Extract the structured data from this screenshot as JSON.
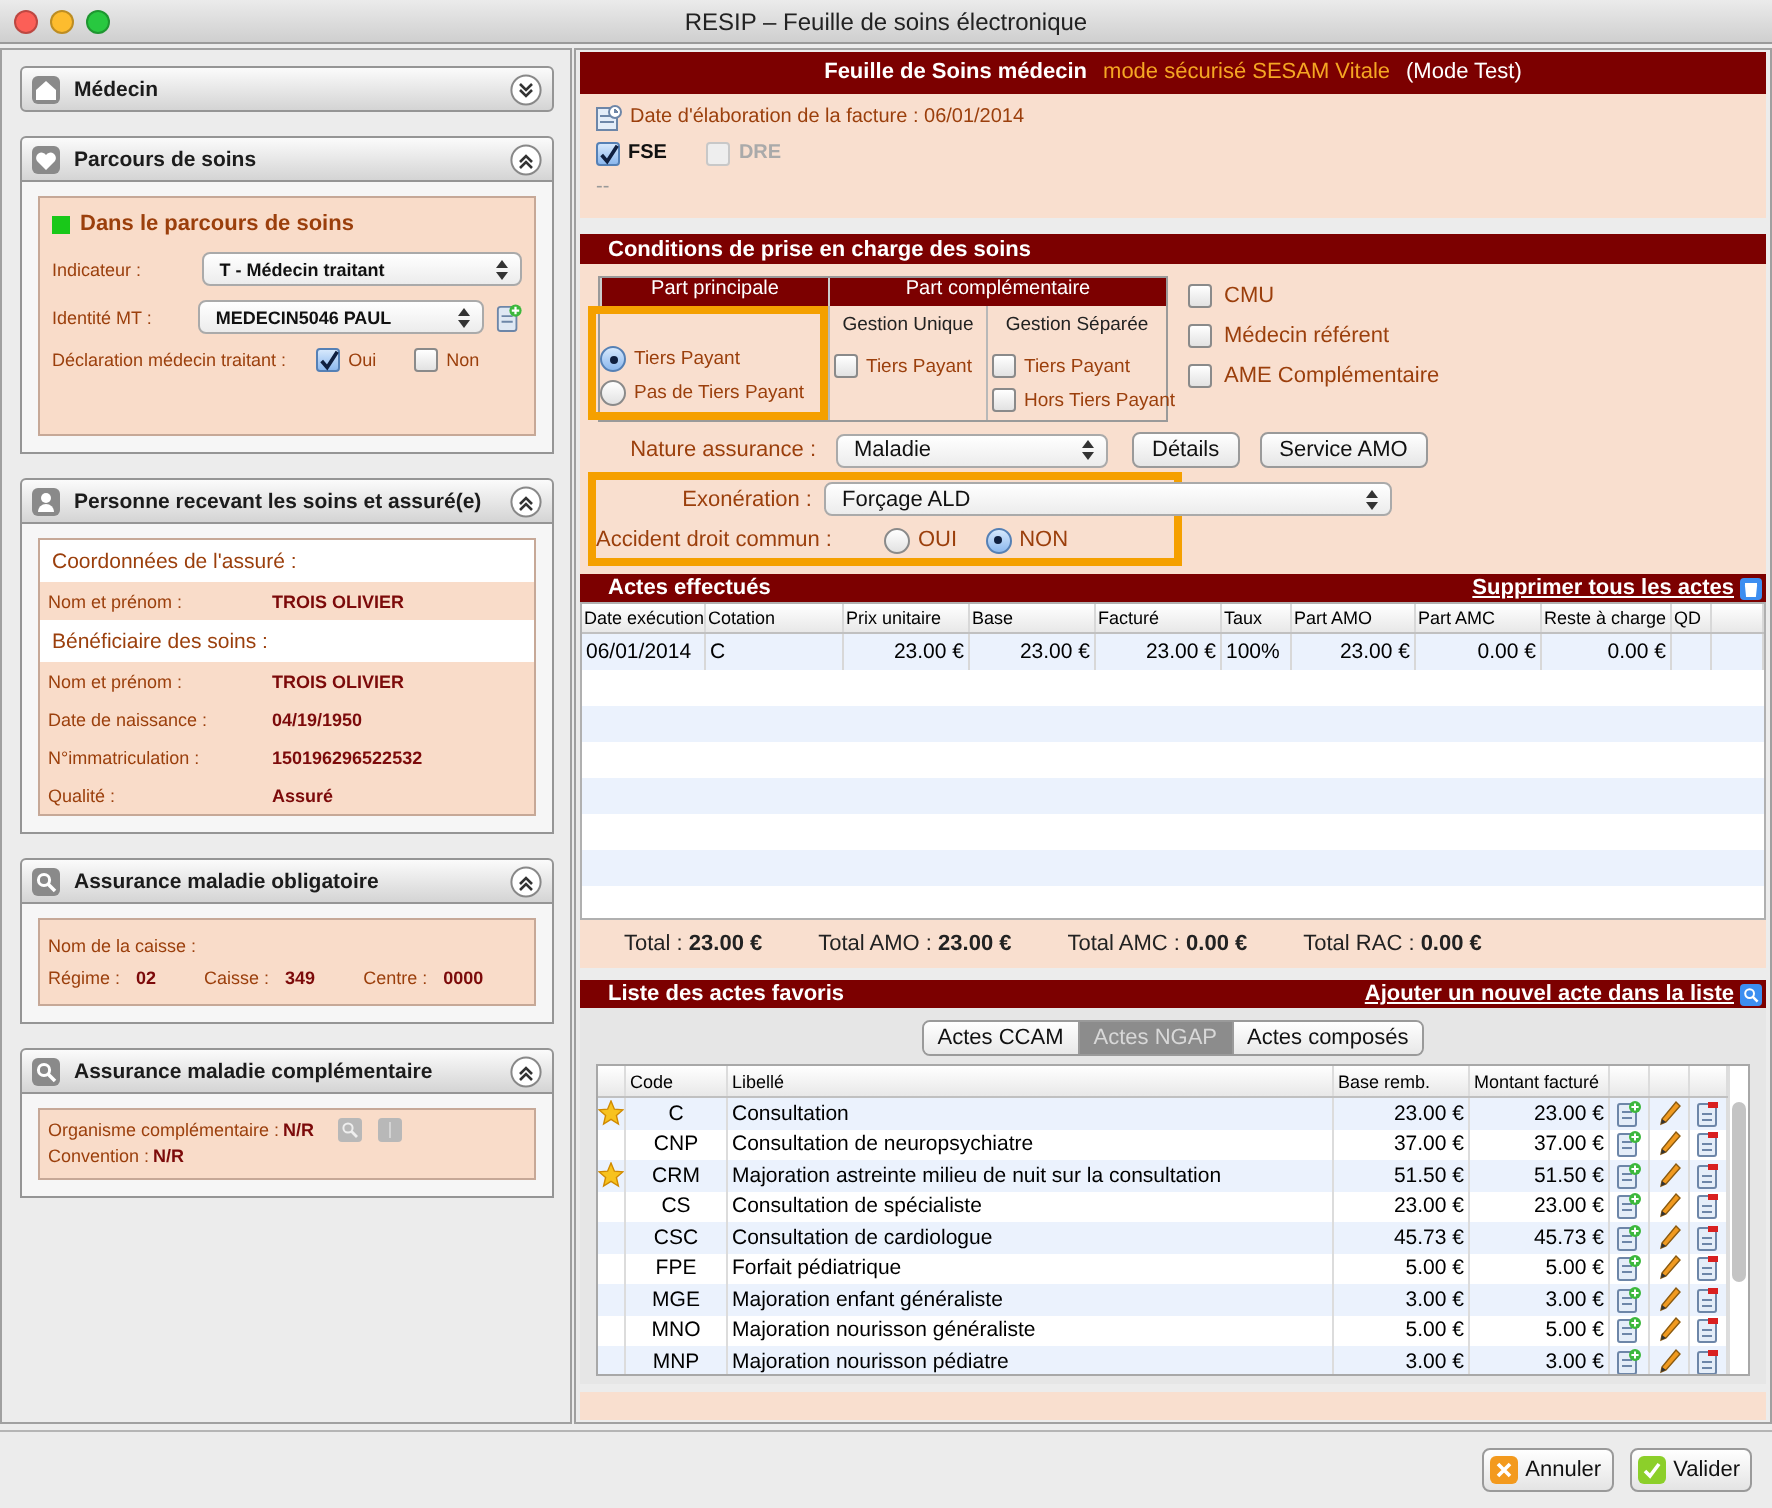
{
  "window": {
    "title": "RESIP – Feuille de soins électronique"
  },
  "sidebar": {
    "panels": [
      {
        "kind": "medecin",
        "title": "Médecin",
        "expanded": false
      },
      {
        "kind": "parcours",
        "title": "Parcours de soins",
        "expanded": true,
        "status": {
          "label": "Dans le parcours de soins",
          "color": "#19c819"
        },
        "indicateur": {
          "label": "Indicateur :",
          "value": "T - Médecin traitant"
        },
        "identite": {
          "label": "Identité MT :",
          "value": "MEDECIN5046 PAUL"
        },
        "declaration": {
          "label": "Déclaration médecin traitant :",
          "options": [
            {
              "label": "Oui",
              "checked": true
            },
            {
              "label": "Non",
              "checked": false
            }
          ]
        }
      },
      {
        "kind": "personne",
        "title": "Personne recevant les soins et assuré(e)",
        "expanded": true,
        "sections": [
          {
            "heading": "Coordonnées de l'assuré :",
            "fields": [
              {
                "label": "Nom et prénom :",
                "value": "TROIS OLIVIER"
              }
            ]
          },
          {
            "heading": "Bénéficiaire des soins :",
            "fields": [
              {
                "label": "Nom et prénom :",
                "value": "TROIS OLIVIER"
              },
              {
                "label": "Date de naissance :",
                "value": "04/19/1950"
              },
              {
                "label": "N°immatriculation :",
                "value": "150196296522532"
              },
              {
                "label": "Qualité :",
                "value": "Assuré"
              }
            ]
          }
        ]
      },
      {
        "kind": "amo",
        "title": "Assurance maladie obligatoire",
        "expanded": true,
        "caisse_label": "Nom de la caisse :",
        "fields": [
          {
            "label": "Régime :",
            "value": "02"
          },
          {
            "label": "Caisse :",
            "value": "349"
          },
          {
            "label": "Centre :",
            "value": "0000"
          }
        ]
      },
      {
        "kind": "amc",
        "title": "Assurance maladie complémentaire",
        "expanded": true,
        "fields": [
          {
            "label": "Organisme complémentaire :",
            "value": "N/R"
          },
          {
            "label": "Convention :",
            "value": "N/R"
          }
        ]
      }
    ]
  },
  "header": {
    "title": "Feuille de Soins médecin",
    "mode": "mode sécurisé SESAM Vitale",
    "test": "(Mode Test)"
  },
  "facture": {
    "date_text": "Date d'élaboration de la facture : 06/01/2014",
    "types": [
      {
        "label": "FSE",
        "checked": true,
        "disabled": false
      },
      {
        "label": "DRE",
        "checked": false,
        "disabled": true
      }
    ],
    "note": "--"
  },
  "conditions": {
    "title": "Conditions de prise en charge des soins",
    "part_principale": {
      "title": "Part principale",
      "options": [
        {
          "label": "Tiers Payant",
          "selected": true
        },
        {
          "label": "Pas de Tiers Payant",
          "selected": false
        }
      ]
    },
    "part_complementaire": {
      "title": "Part complémentaire",
      "groups": [
        {
          "title": "Gestion Unique",
          "options": [
            {
              "label": "Tiers Payant",
              "checked": false
            }
          ]
        },
        {
          "title": "Gestion Séparée",
          "options": [
            {
              "label": "Tiers Payant",
              "checked": false
            },
            {
              "label": "Hors Tiers Payant",
              "checked": false
            }
          ]
        }
      ]
    },
    "flags": [
      {
        "label": "CMU",
        "checked": false
      },
      {
        "label": "Médecin référent",
        "checked": false
      },
      {
        "label": "AME Complémentaire",
        "checked": false
      }
    ],
    "nature": {
      "label": "Nature assurance :",
      "value": "Maladie"
    },
    "buttons": [
      "Détails",
      "Service AMO"
    ],
    "exoneration": {
      "label": "Exonération :",
      "value": "Forçage ALD"
    },
    "accident": {
      "label": "Accident droit commun :",
      "options": [
        {
          "label": "OUI",
          "selected": false
        },
        {
          "label": "NON",
          "selected": true
        }
      ]
    }
  },
  "actes": {
    "title": "Actes effectués",
    "delete_link": "Supprimer tous les actes",
    "columns": [
      "Date exécution",
      "Cotation",
      "Prix unitaire",
      "Base",
      "Facturé",
      "Taux",
      "Part AMO",
      "Part AMC",
      "Reste à charge",
      "QD"
    ],
    "rows": [
      [
        "06/01/2014",
        "C",
        "23.00 €",
        "23.00 €",
        "23.00 €",
        "100%",
        "23.00 €",
        "0.00 €",
        "0.00 €"
      ]
    ],
    "totals": [
      "Total : **23.00 €**",
      "Total AMO : **23.00 €**",
      "Total AMC : **0.00 €**",
      "Total RAC : **0.00 €**"
    ]
  },
  "favoris": {
    "title": "Liste des actes favoris",
    "add_link": "Ajouter un nouvel acte dans la liste",
    "tabs": [
      {
        "label": "Actes CCAM",
        "selected": false
      },
      {
        "label": "Actes NGAP",
        "selected": true
      },
      {
        "label": "Actes composés",
        "selected": false
      }
    ],
    "columns": [
      "Code",
      "Libellé",
      "Base remb.",
      "Montant facturé"
    ],
    "rows": [
      {
        "favorite": true,
        "code": "C",
        "label": "Consultation",
        "base": "23.00 €",
        "amount": "23.00 €"
      },
      {
        "favorite": false,
        "code": "CNP",
        "label": "Consultation de neuropsychiatre",
        "base": "37.00 €",
        "amount": "37.00 €"
      },
      {
        "favorite": true,
        "code": "CRM",
        "label": "Majoration astreinte milieu de nuit sur la consultation",
        "base": "51.50 €",
        "amount": "51.50 €"
      },
      {
        "favorite": false,
        "code": "CS",
        "label": "Consultation de spécialiste",
        "base": "23.00 €",
        "amount": "23.00 €"
      },
      {
        "favorite": false,
        "code": "CSC",
        "label": "Consultation de cardiologue",
        "base": "45.73 €",
        "amount": "45.73 €"
      },
      {
        "favorite": false,
        "code": "FPE",
        "label": "Forfait pédiatrique",
        "base": "5.00 €",
        "amount": "5.00 €"
      },
      {
        "favorite": false,
        "code": "MGE",
        "label": "Majoration enfant généraliste",
        "base": "3.00 €",
        "amount": "3.00 €"
      },
      {
        "favorite": false,
        "code": "MNO",
        "label": "Majoration nourisson généraliste",
        "base": "5.00 €",
        "amount": "5.00 €"
      },
      {
        "favorite": false,
        "code": "MNP",
        "label": "Majoration nourisson pédiatre",
        "base": "3.00 €",
        "amount": "3.00 €"
      }
    ]
  },
  "buttons": [
    {
      "kind": "cancel",
      "label": "Annuler"
    },
    {
      "kind": "ok",
      "label": "Valider"
    }
  ]
}
